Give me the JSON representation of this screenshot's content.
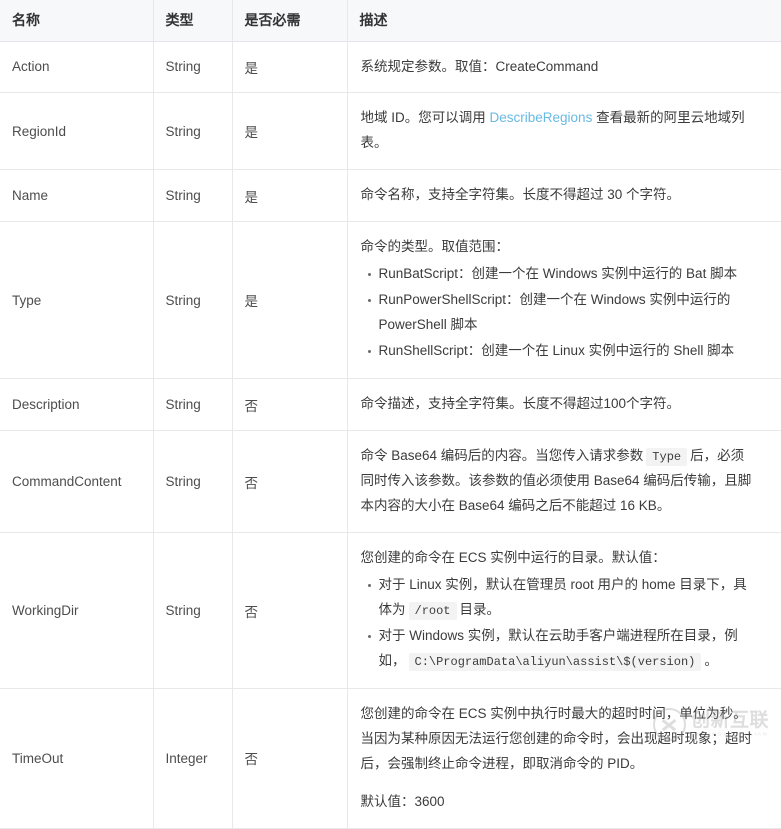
{
  "table": {
    "columns": [
      {
        "key": "name",
        "label": "名称"
      },
      {
        "key": "type",
        "label": "类型"
      },
      {
        "key": "req",
        "label": "是否必需"
      },
      {
        "key": "desc",
        "label": "描述"
      }
    ],
    "rows": [
      {
        "name": "Action",
        "type": "String",
        "required": "是",
        "desc_paragraphs": [
          {
            "parts": [
              {
                "t": "text",
                "v": "系统规定参数。取值：CreateCommand"
              }
            ]
          }
        ]
      },
      {
        "name": "RegionId",
        "type": "String",
        "required": "是",
        "desc_paragraphs": [
          {
            "parts": [
              {
                "t": "text",
                "v": "地域 ID。您可以调用 "
              },
              {
                "t": "link",
                "v": "DescribeRegions"
              },
              {
                "t": "text",
                "v": " 查看最新的阿里云地域列表。"
              }
            ]
          }
        ]
      },
      {
        "name": "Name",
        "type": "String",
        "required": "是",
        "desc_paragraphs": [
          {
            "parts": [
              {
                "t": "text",
                "v": "命令名称，支持全字符集。长度不得超过 30 个字符。"
              }
            ]
          }
        ]
      },
      {
        "name": "Type",
        "type": "String",
        "required": "是",
        "desc_paragraphs": [
          {
            "parts": [
              {
                "t": "text",
                "v": "命令的类型。取值范围："
              }
            ]
          }
        ],
        "desc_list": [
          {
            "parts": [
              {
                "t": "text",
                "v": "RunBatScript：创建一个在 Windows 实例中运行的 Bat 脚本"
              }
            ]
          },
          {
            "parts": [
              {
                "t": "text",
                "v": "RunPowerShellScript：创建一个在 Windows 实例中运行的 PowerShell 脚本"
              }
            ]
          },
          {
            "parts": [
              {
                "t": "text",
                "v": "RunShellScript：创建一个在 Linux 实例中运行的 Shell 脚本"
              }
            ]
          }
        ]
      },
      {
        "name": "Description",
        "type": "String",
        "required": "否",
        "desc_paragraphs": [
          {
            "parts": [
              {
                "t": "text",
                "v": "命令描述，支持全字符集。长度不得超过100个字符。"
              }
            ]
          }
        ]
      },
      {
        "name": "CommandContent",
        "type": "String",
        "required": "否",
        "desc_paragraphs": [
          {
            "parts": [
              {
                "t": "text",
                "v": "命令 Base64 编码后的内容。当您传入请求参数"
              },
              {
                "t": "code",
                "v": "Type"
              },
              {
                "t": "text",
                "v": "后，必须同时传入该参数。该参数的值必须使用 Base64 编码后传输，且脚本内容的大小在 Base64 编码之后不能超过 16 KB。"
              }
            ]
          }
        ]
      },
      {
        "name": "WorkingDir",
        "type": "String",
        "required": "否",
        "desc_paragraphs": [
          {
            "parts": [
              {
                "t": "text",
                "v": "您创建的命令在 ECS 实例中运行的目录。默认值："
              }
            ]
          }
        ],
        "desc_list": [
          {
            "parts": [
              {
                "t": "text",
                "v": "对于 Linux 实例，默认在管理员 root 用户的 home 目录下，具体为"
              },
              {
                "t": "code",
                "v": "/root"
              },
              {
                "t": "text",
                "v": "目录。"
              }
            ]
          },
          {
            "parts": [
              {
                "t": "text",
                "v": "对于 Windows 实例，默认在云助手客户端进程所在目录，例如，"
              },
              {
                "t": "code",
                "v": "C:\\ProgramData\\aliyun\\assist\\$(version)"
              },
              {
                "t": "text",
                "v": "。"
              }
            ]
          }
        ]
      },
      {
        "name": "TimeOut",
        "type": "Integer",
        "required": "否",
        "desc_paragraphs": [
          {
            "parts": [
              {
                "t": "text",
                "v": "您创建的命令在 ECS 实例中执行时最大的超时时间，单位为秒。当因为某种原因无法运行您创建的命令时，会出现超时现象；超时后，会强制终止命令进程，即取消命令的 PID。"
              }
            ]
          },
          {
            "parts": [
              {
                "t": "text",
                "v": "默认值：3600"
              }
            ]
          }
        ]
      }
    ]
  },
  "watermark": {
    "main_text": "创新互联",
    "sub_text": "CHUANGXIN HULIAN"
  },
  "colors": {
    "link": "#68b9e3",
    "header_bg": "#f7f8fa",
    "border": "#e8e8e8",
    "code_bg": "#f3f3f3",
    "text": "#4a4a4a"
  }
}
